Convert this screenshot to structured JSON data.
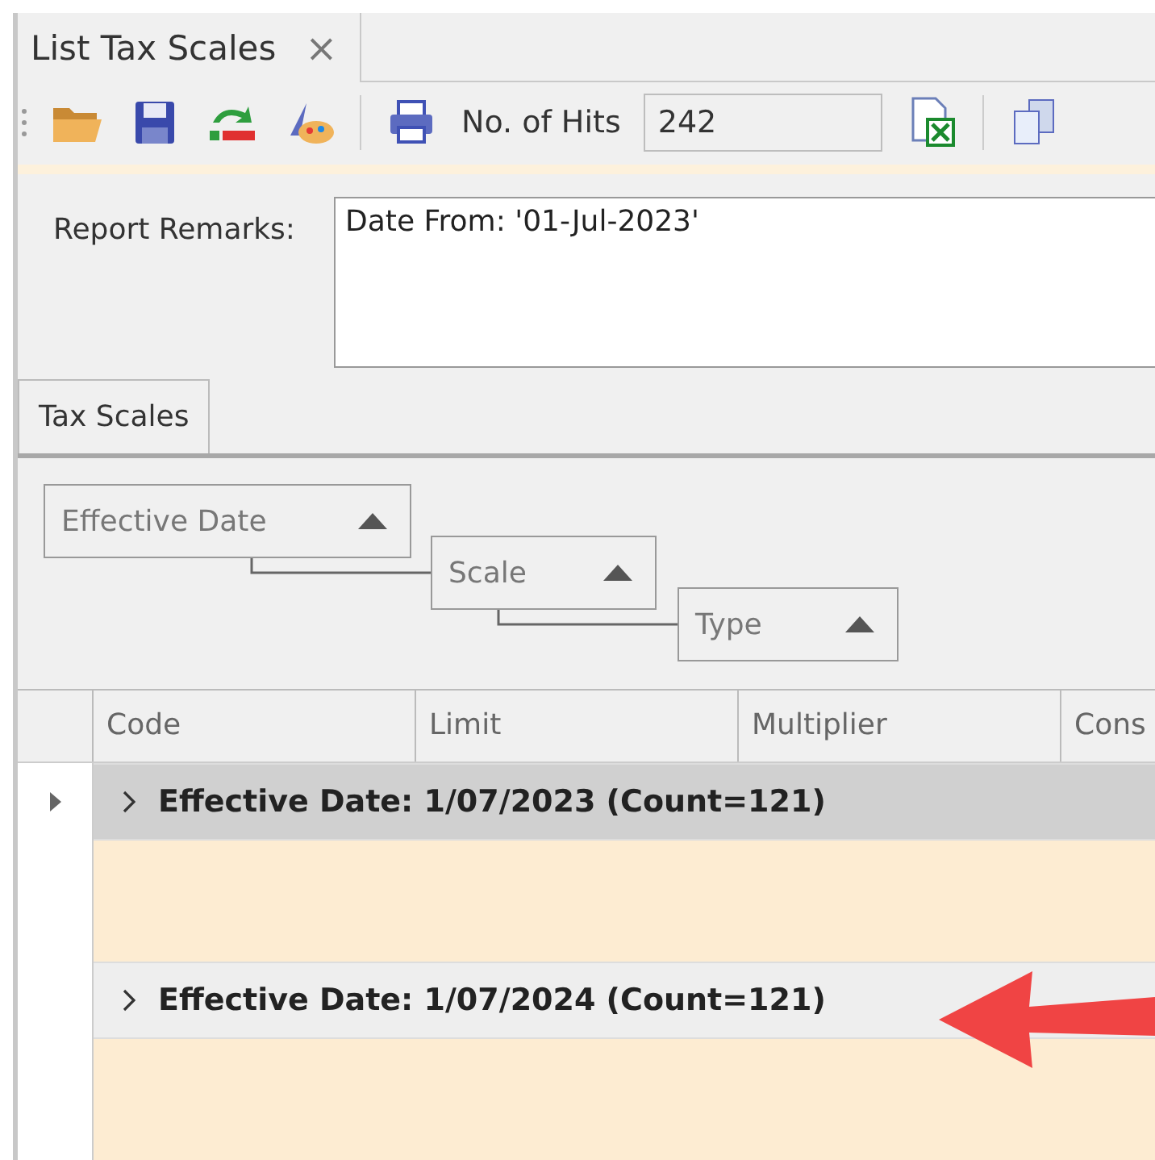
{
  "document_tab": {
    "title": "List Tax Scales",
    "close": "×"
  },
  "toolbar": {
    "hits_label": "No. of Hits",
    "hits_value": "242"
  },
  "remarks": {
    "label": "Report Remarks:",
    "value": "Date From: '01-Jul-2023'"
  },
  "tabs": [
    {
      "label": "Tax Scales",
      "selected": true
    }
  ],
  "group_by": [
    {
      "label": "Effective Date"
    },
    {
      "label": "Scale"
    },
    {
      "label": "Type"
    }
  ],
  "columns": [
    "Code",
    "Limit",
    "Multiplier",
    "Cons"
  ],
  "groups": [
    {
      "label": "Effective Date: 1/07/2023 (Count=121)",
      "selected": true,
      "expanded": false
    },
    {
      "label": "Effective Date: 1/07/2024 (Count=121)",
      "selected": false,
      "expanded": false
    }
  ]
}
